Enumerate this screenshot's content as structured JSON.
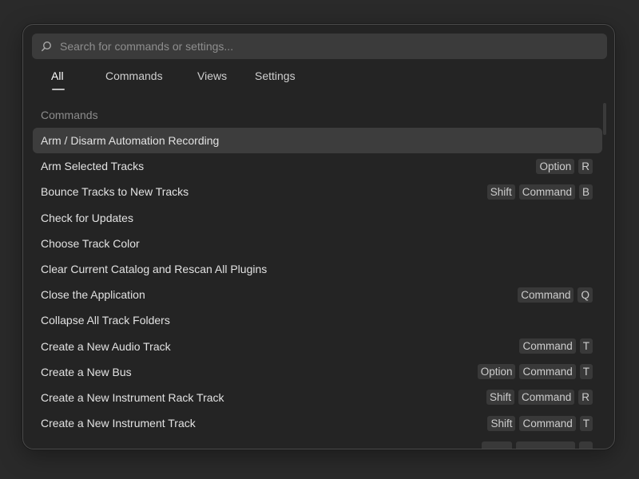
{
  "search": {
    "placeholder": "Search for commands or settings..."
  },
  "tabs": [
    {
      "label": "All",
      "active": true
    },
    {
      "label": "Commands",
      "active": false
    },
    {
      "label": "Views",
      "active": false
    },
    {
      "label": "Settings",
      "active": false
    }
  ],
  "section": {
    "label": "Commands"
  },
  "commands": [
    {
      "label": "Arm / Disarm Automation Recording",
      "keys": [],
      "selected": true
    },
    {
      "label": "Arm Selected Tracks",
      "keys": [
        "Option",
        "R"
      ]
    },
    {
      "label": "Bounce Tracks to New Tracks",
      "keys": [
        "Shift",
        "Command",
        "B"
      ]
    },
    {
      "label": "Check for Updates",
      "keys": []
    },
    {
      "label": "Choose Track Color",
      "keys": []
    },
    {
      "label": "Clear Current Catalog and Rescan All Plugins",
      "keys": []
    },
    {
      "label": "Close the Application",
      "keys": [
        "Command",
        "Q"
      ]
    },
    {
      "label": "Collapse All Track Folders",
      "keys": []
    },
    {
      "label": "Create a New Audio Track",
      "keys": [
        "Command",
        "T"
      ]
    },
    {
      "label": "Create a New Bus",
      "keys": [
        "Option",
        "Command",
        "T"
      ]
    },
    {
      "label": "Create a New Instrument Rack Track",
      "keys": [
        "Shift",
        "Command",
        "R"
      ]
    },
    {
      "label": "Create a New Instrument Track",
      "keys": [
        "Shift",
        "Command",
        "T"
      ]
    }
  ],
  "colors": {
    "background": "#2a2a2a",
    "panel": "#242424",
    "selected_row": "#3d3d3d",
    "key_chip": "#393939"
  },
  "icons": {
    "search": "search-icon"
  }
}
